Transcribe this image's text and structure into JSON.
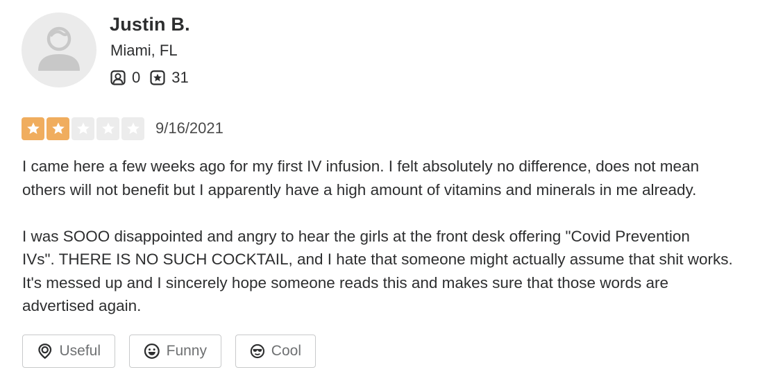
{
  "user": {
    "name": "Justin B.",
    "location": "Miami, FL",
    "friends_count": "0",
    "reviews_count": "31",
    "avatar_icon": "default-avatar-icon",
    "friends_icon": "friends-icon",
    "reviews_icon": "reviews-star-icon"
  },
  "review": {
    "rating": 2,
    "rating_max": 5,
    "date": "9/16/2021",
    "paragraph_1_line_1": "I came here a few weeks ago for my first IV infusion. I felt absolutely no difference, does not mean",
    "paragraph_1_line_2": "others will not benefit but I apparently have a high amount of vitamins and minerals in me already.",
    "paragraph_2_line_1": "I was SOOO disappointed and angry to hear the girls at the front desk offering \"Covid Prevention",
    "paragraph_2_line_2": "IVs\". THERE IS NO SUCH COCKTAIL, and I hate that someone might actually assume that shit works.",
    "paragraph_2_line_3": "It's messed up and I sincerely hope someone reads this and makes sure that those words are",
    "paragraph_2_line_4": "advertised again."
  },
  "reactions": {
    "useful_label": "Useful",
    "funny_label": "Funny",
    "cool_label": "Cool",
    "useful_icon": "useful-lightbulb-icon",
    "funny_icon": "funny-face-icon",
    "cool_icon": "cool-sunglasses-icon"
  },
  "colors": {
    "star_filled": "#f0ad5e",
    "star_empty": "#ececec",
    "text": "#2d2e2f",
    "button_border": "#c8c9ca"
  }
}
